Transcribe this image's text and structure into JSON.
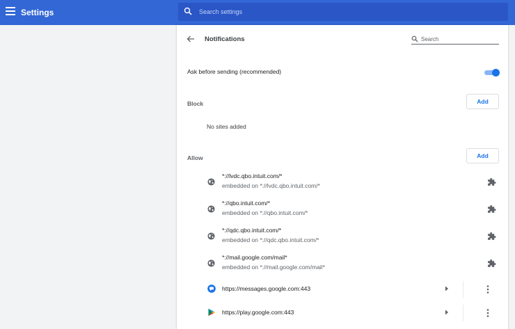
{
  "app": {
    "title": "Settings"
  },
  "search": {
    "placeholder": "Search settings"
  },
  "page": {
    "title": "Notifications",
    "search_placeholder": "Search",
    "ask_label": "Ask before sending (recommended)",
    "ask_enabled": true,
    "block": {
      "label": "Block",
      "add_label": "Add",
      "empty_text": "No sites added"
    },
    "allow": {
      "label": "Allow",
      "add_label": "Add"
    }
  },
  "allow_sites": [
    {
      "pattern": "*://lvdc.qbo.intuit.com/*",
      "embedded": "embedded on *://lvdc.qbo.intuit.com/*",
      "icon": "globe-icon",
      "action_icon": "extension-icon"
    },
    {
      "pattern": "*://qbo.intuit.com/*",
      "embedded": "embedded on *://qbo.intuit.com/*",
      "icon": "globe-icon",
      "action_icon": "extension-icon"
    },
    {
      "pattern": "*://qdc.qbo.intuit.com/*",
      "embedded": "embedded on *://qdc.qbo.intuit.com/*",
      "icon": "globe-icon",
      "action_icon": "extension-icon"
    },
    {
      "pattern": "*://mail.google.com/mail*",
      "embedded": "embedded on *://mail.google.com/mail*",
      "icon": "globe-icon",
      "action_icon": "extension-icon"
    },
    {
      "pattern": "https://messages.google.com:443",
      "icon": "messages-icon"
    },
    {
      "pattern": "https://play.google.com:443",
      "icon": "play-store-icon"
    }
  ],
  "colors": {
    "header": "#3367d6",
    "search_bg": "#2a56c6",
    "accent": "#1a73e8"
  }
}
